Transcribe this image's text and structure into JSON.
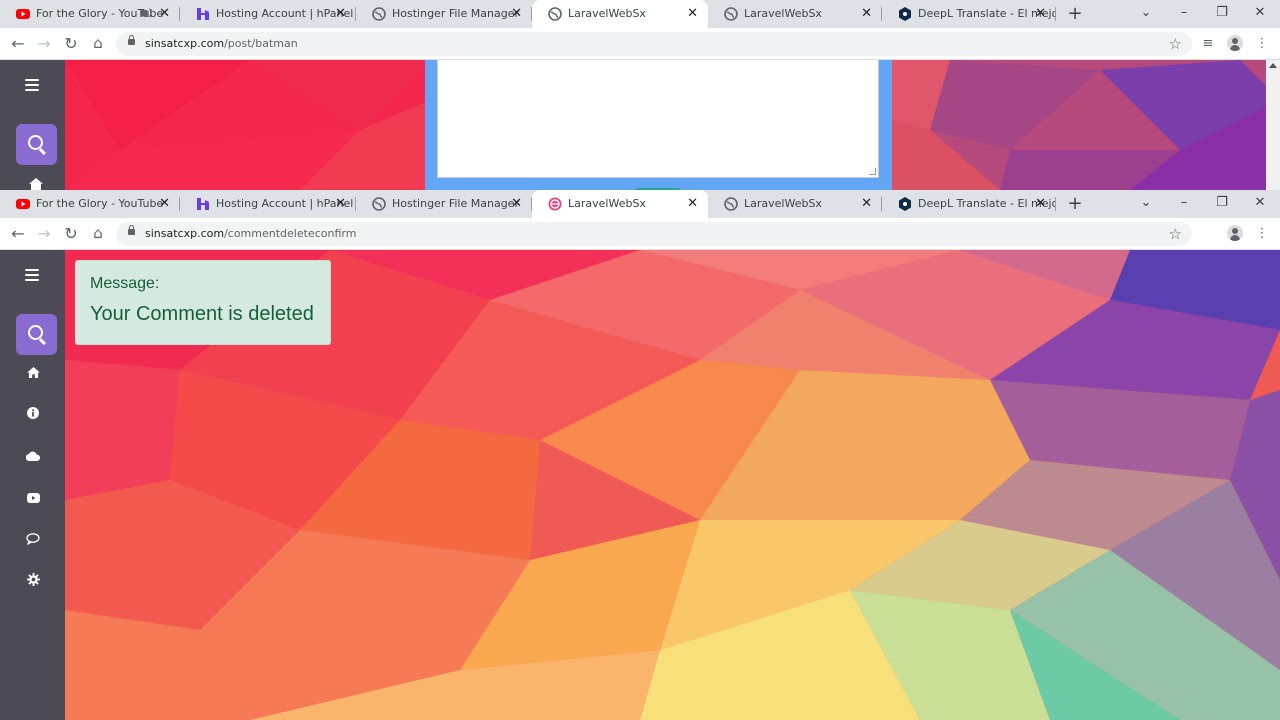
{
  "window1": {
    "tabs": [
      {
        "title": "For the Glory - YouTube",
        "icon": "youtube-icon"
      },
      {
        "title": "Hosting Account | hPanel",
        "icon": "hostinger-icon"
      },
      {
        "title": "Hostinger File Manager",
        "icon": "globe-icon"
      },
      {
        "title": "LaravelWebSx",
        "icon": "globe-icon"
      },
      {
        "title": "LaravelWebSx",
        "icon": "globe-icon"
      },
      {
        "title": "DeepL Translate - El mejor t",
        "icon": "deepl-icon"
      }
    ],
    "url": {
      "host": "sinsatcxp.com",
      "path": "/post/batman"
    }
  },
  "window2": {
    "tabs": [
      {
        "title": "For the Glory - YouTube",
        "icon": "youtube-icon"
      },
      {
        "title": "Hosting Account | hPanel",
        "icon": "hostinger-icon"
      },
      {
        "title": "Hostinger File Manager",
        "icon": "globe-icon"
      },
      {
        "title": "LaravelWebSx",
        "icon": "laravel-icon"
      },
      {
        "title": "LaravelWebSx",
        "icon": "globe-icon"
      },
      {
        "title": "DeepL Translate - El mejor t",
        "icon": "deepl-icon"
      }
    ],
    "url": {
      "host": "sinsatcxp.com",
      "path": "/commentdeleteconfirm"
    },
    "message": {
      "label": "Message:",
      "text": "Your Comment is deleted"
    },
    "sidebar_icons": [
      "home-icon",
      "info-icon",
      "cloud-icon",
      "youtube-icon",
      "comment-icon",
      "settings-icon"
    ]
  },
  "colors": {
    "sidebar": "#4b4a55",
    "search_button": "#8a6bd1",
    "message_bg": "#d4e9df",
    "message_text": "#155f38",
    "comment_panel": "#64a6f6"
  }
}
